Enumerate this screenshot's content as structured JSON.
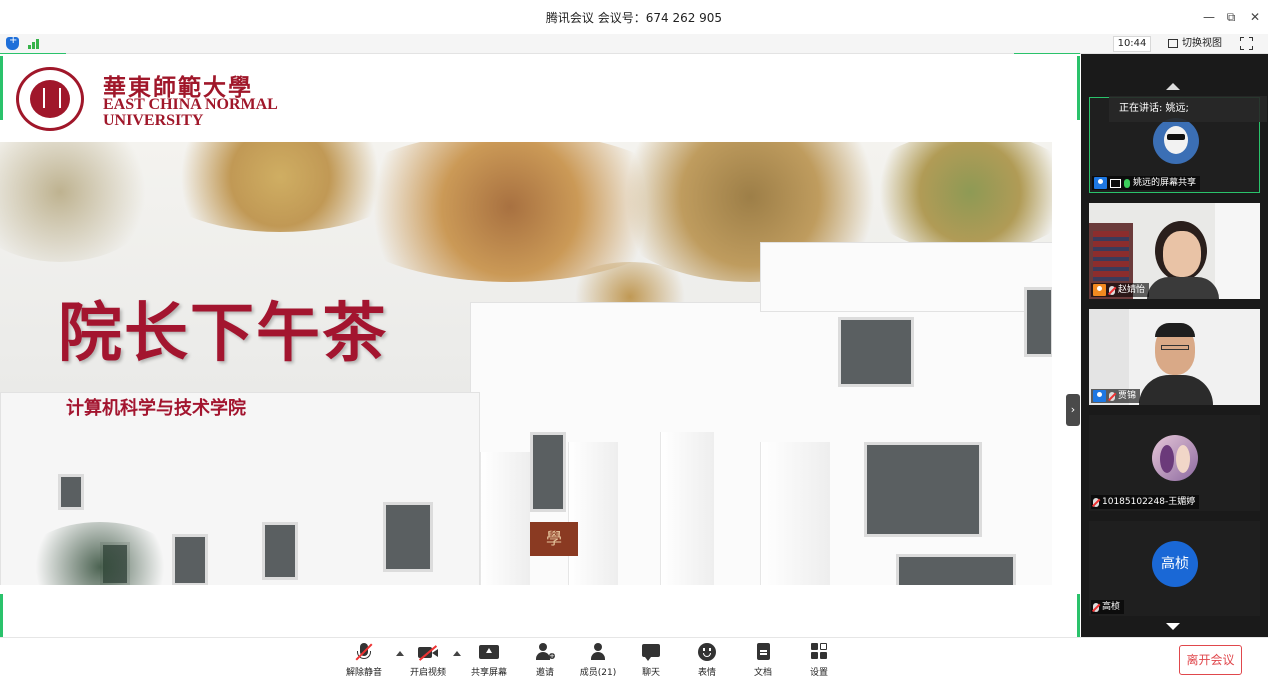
{
  "window": {
    "title": "腾讯会议 会议号：674 262 905",
    "controls": {
      "minimize": "—",
      "restore": "⧉",
      "close": "✕"
    }
  },
  "status_bar": {
    "time": "10:44",
    "switch_view_label": "切换视图"
  },
  "slide": {
    "university_cn": "華東師範大學",
    "university_en_line1": "EAST CHINA NORMAL",
    "university_en_line2": "UNIVERSITY",
    "main_title": "院长下午茶",
    "subtitle": "计算机科学与技术学院",
    "sign_text": "學"
  },
  "speaking_banner": "正在讲话: 姚远;",
  "participants": [
    {
      "name": "姚远的屏幕共享",
      "mic": "on",
      "screen_share": true,
      "avatar": "dog-avatar",
      "active": true
    },
    {
      "name": "赵婧怡",
      "mic": "off",
      "avatar": "video-woman"
    },
    {
      "name": "贾锦",
      "mic": "off",
      "avatar": "video-man"
    },
    {
      "name": "10185102248-王媚婷",
      "mic": "off",
      "avatar": "anime-avatar"
    },
    {
      "name": "高桢",
      "mic": "off",
      "avatar": "text-avatar",
      "avatar_text": "高桢"
    }
  ],
  "toolbar": {
    "unmute": "解除静音",
    "start_video": "开启视频",
    "share_screen": "共享屏幕",
    "invite": "邀请",
    "members": "成员(21)",
    "chat": "聊天",
    "reactions": "表情",
    "docs": "文档",
    "settings": "设置",
    "leave": "离开会议"
  },
  "colors": {
    "brand_red": "#a3152f",
    "accent_green": "#2ac26b",
    "leave_red": "#e0474c",
    "panel_bg": "#1a1a1a"
  }
}
